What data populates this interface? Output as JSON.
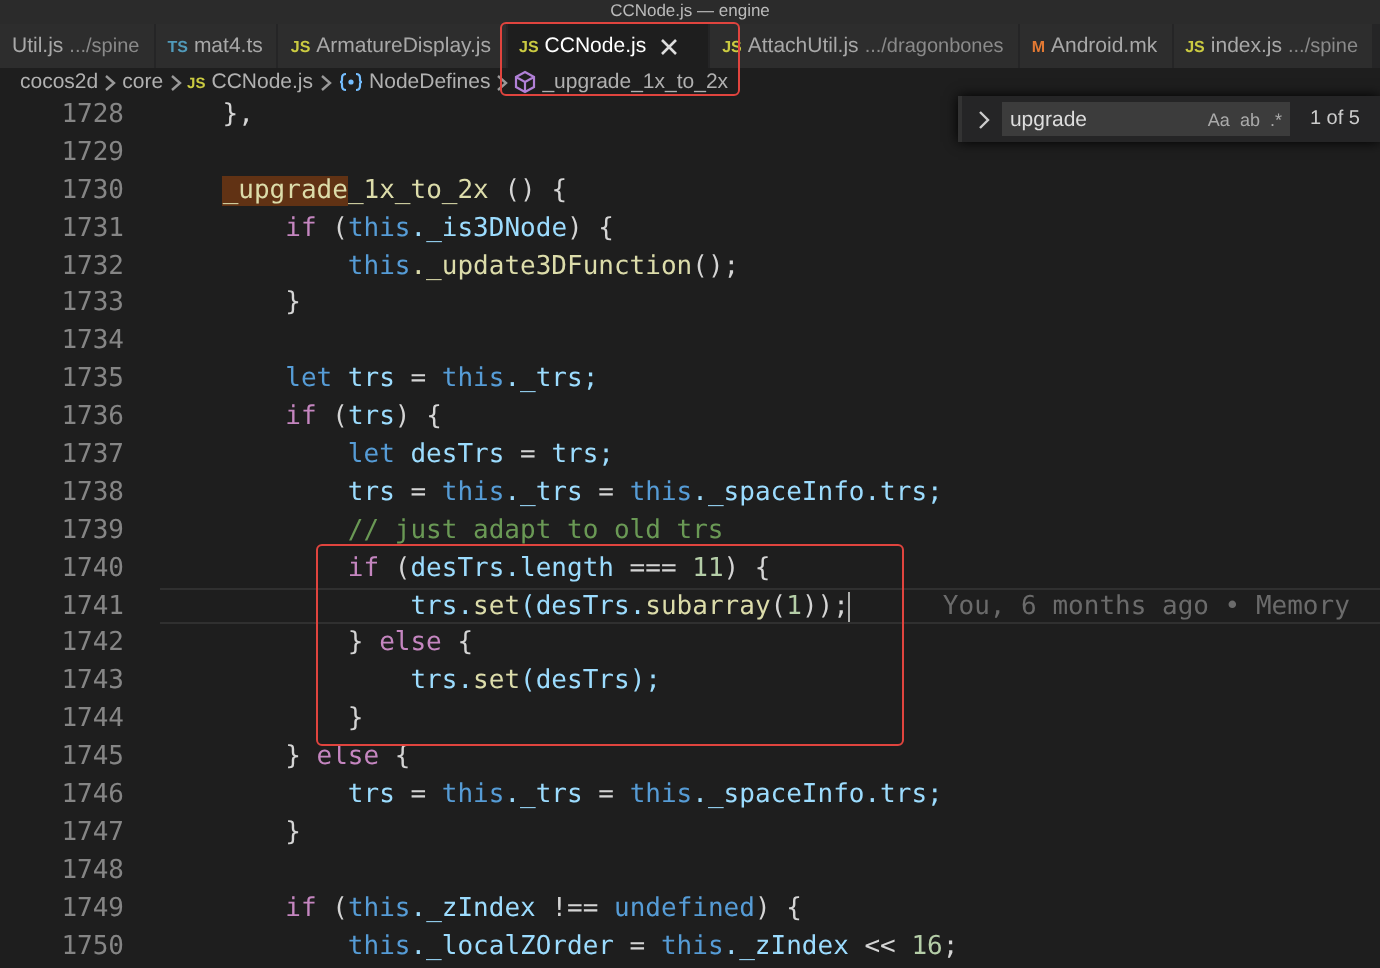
{
  "window": {
    "title": "CCNode.js — engine"
  },
  "tabs": [
    {
      "label": "Util.js",
      "path": ".../spine",
      "selected": false
    },
    {
      "label": "mat4.ts",
      "badge": "TS",
      "kind": "ts",
      "selected": false
    },
    {
      "label": "ArmatureDisplay.js",
      "badge": "JS",
      "kind": "js",
      "selected": false
    },
    {
      "label": "CCNode.js",
      "badge": "JS",
      "kind": "js",
      "selected": true
    },
    {
      "label": "AttachUtil.js",
      "path": ".../dragonbones",
      "badge": "JS",
      "kind": "js",
      "selected": false
    },
    {
      "label": "Android.mk",
      "badge": "M",
      "kind": "make",
      "selected": false
    },
    {
      "label": "index.js",
      "path": ".../spine",
      "badge": "JS",
      "kind": "js",
      "selected": false
    }
  ],
  "breadcrumbs": [
    {
      "label": "cocos2d",
      "kind": "folder"
    },
    {
      "label": "core",
      "kind": "folder"
    },
    {
      "label": "CCNode.js",
      "badge": "JS",
      "kind": "file"
    },
    {
      "label": "NodeDefines",
      "kind": "namespace"
    },
    {
      "label": "_upgrade_1x_to_2x",
      "kind": "method"
    }
  ],
  "find_widget": {
    "value": "upgrade",
    "toggles": [
      "Aa",
      "ab",
      ".*"
    ],
    "result": "1 of 5"
  },
  "lines": [
    {
      "number": "1728",
      "current": false,
      "tokens": [
        {
          "text": "    },",
          "kind": "plain"
        }
      ]
    },
    {
      "number": "1729",
      "current": false
    },
    {
      "number": "1730",
      "current": false,
      "tokens": [
        {
          "text": "    _upgrade",
          "kind": "match"
        },
        {
          "text": "_1x_to_2x",
          "kind": "function"
        },
        {
          "text": " () {",
          "kind": "plain"
        }
      ]
    },
    {
      "number": "1731",
      "current": false,
      "tokens": [
        {
          "text": "        if",
          "kind": "keyword"
        },
        {
          "text": " (",
          "kind": "plain"
        },
        {
          "text": "this",
          "kind": "storage"
        },
        {
          "text": "._is3DNode",
          "kind": "variable"
        },
        {
          "text": ") {",
          "kind": "plain"
        }
      ]
    },
    {
      "number": "1732",
      "current": false,
      "tokens": [
        {
          "text": "            this",
          "kind": "storage"
        },
        {
          "text": "._update3DFunction",
          "kind": "function"
        },
        {
          "text": "();",
          "kind": "plain"
        }
      ]
    },
    {
      "number": "1733",
      "current": false,
      "tokens": [
        {
          "text": "        }",
          "kind": "plain"
        }
      ]
    },
    {
      "number": "1734",
      "current": false
    },
    {
      "number": "1735",
      "current": false,
      "tokens": [
        {
          "text": "        let",
          "kind": "storage"
        },
        {
          "text": " trs",
          "kind": "variable"
        },
        {
          "text": " = ",
          "kind": "plain"
        },
        {
          "text": "this",
          "kind": "storage"
        },
        {
          "text": "._trs;",
          "kind": "variable"
        }
      ]
    },
    {
      "number": "1736",
      "current": false,
      "tokens": [
        {
          "text": "        if",
          "kind": "keyword"
        },
        {
          "text": " (",
          "kind": "plain"
        },
        {
          "text": "trs",
          "kind": "variable"
        },
        {
          "text": ") {",
          "kind": "plain"
        }
      ]
    },
    {
      "number": "1737",
      "current": false,
      "tokens": [
        {
          "text": "            let",
          "kind": "storage"
        },
        {
          "text": " desTrs",
          "kind": "variable"
        },
        {
          "text": " = ",
          "kind": "plain"
        },
        {
          "text": "trs;",
          "kind": "variable"
        }
      ]
    },
    {
      "number": "1738",
      "current": false,
      "tokens": [
        {
          "text": "            trs",
          "kind": "variable"
        },
        {
          "text": " = ",
          "kind": "plain"
        },
        {
          "text": "this",
          "kind": "storage"
        },
        {
          "text": "._trs",
          "kind": "variable"
        },
        {
          "text": " = ",
          "kind": "plain"
        },
        {
          "text": "this",
          "kind": "storage"
        },
        {
          "text": "._spaceInfo.trs;",
          "kind": "variable"
        }
      ]
    },
    {
      "number": "1739",
      "current": false,
      "tokens": [
        {
          "text": "            // just adapt to old trs",
          "kind": "comment"
        }
      ]
    },
    {
      "number": "1740",
      "current": false,
      "tokens": [
        {
          "text": "            if",
          "kind": "keyword"
        },
        {
          "text": " (",
          "kind": "plain"
        },
        {
          "text": "desTrs.length",
          "kind": "variable"
        },
        {
          "text": " === ",
          "kind": "plain"
        },
        {
          "text": "11",
          "kind": "number"
        },
        {
          "text": ") {",
          "kind": "plain"
        }
      ]
    },
    {
      "number": "1741",
      "current": true,
      "blame": "You, 6 months ago • Memory",
      "tokens": [
        {
          "text": "                trs.",
          "kind": "variable"
        },
        {
          "text": "set",
          "kind": "function"
        },
        {
          "text": "(desTrs.",
          "kind": "variable"
        },
        {
          "text": "subarray",
          "kind": "function"
        },
        {
          "text": "(",
          "kind": "plain"
        },
        {
          "text": "1",
          "kind": "number"
        },
        {
          "text": "));",
          "kind": "plain"
        }
      ]
    },
    {
      "number": "1742",
      "current": false,
      "tokens": [
        {
          "text": "            } ",
          "kind": "plain"
        },
        {
          "text": "else",
          "kind": "keyword"
        },
        {
          "text": " {",
          "kind": "plain"
        }
      ]
    },
    {
      "number": "1743",
      "current": false,
      "tokens": [
        {
          "text": "                trs.",
          "kind": "variable"
        },
        {
          "text": "set",
          "kind": "function"
        },
        {
          "text": "(desTrs);",
          "kind": "variable"
        }
      ]
    },
    {
      "number": "1744",
      "current": false,
      "tokens": [
        {
          "text": "            }",
          "kind": "plain"
        }
      ]
    },
    {
      "number": "1745",
      "current": false,
      "tokens": [
        {
          "text": "        } ",
          "kind": "plain"
        },
        {
          "text": "else",
          "kind": "keyword"
        },
        {
          "text": " {",
          "kind": "plain"
        }
      ]
    },
    {
      "number": "1746",
      "current": false,
      "tokens": [
        {
          "text": "            trs",
          "kind": "variable"
        },
        {
          "text": " = ",
          "kind": "plain"
        },
        {
          "text": "this",
          "kind": "storage"
        },
        {
          "text": "._trs",
          "kind": "variable"
        },
        {
          "text": " = ",
          "kind": "plain"
        },
        {
          "text": "this",
          "kind": "storage"
        },
        {
          "text": "._spaceInfo.trs;",
          "kind": "variable"
        }
      ]
    },
    {
      "number": "1747",
      "current": false,
      "tokens": [
        {
          "text": "        }",
          "kind": "plain"
        }
      ]
    },
    {
      "number": "1748",
      "current": false
    },
    {
      "number": "1749",
      "current": false,
      "tokens": [
        {
          "text": "        if",
          "kind": "keyword"
        },
        {
          "text": " (",
          "kind": "plain"
        },
        {
          "text": "this",
          "kind": "storage"
        },
        {
          "text": "._zIndex",
          "kind": "variable"
        },
        {
          "text": " !== ",
          "kind": "plain"
        },
        {
          "text": "undefined",
          "kind": "storage"
        },
        {
          "text": ") {",
          "kind": "plain"
        }
      ]
    },
    {
      "number": "1750",
      "current": false,
      "tokens": [
        {
          "text": "            this",
          "kind": "storage"
        },
        {
          "text": "._localZOrder",
          "kind": "variable"
        },
        {
          "text": " = ",
          "kind": "plain"
        },
        {
          "text": "this",
          "kind": "storage"
        },
        {
          "text": "._zIndex",
          "kind": "variable"
        },
        {
          "text": " << ",
          "kind": "plain"
        },
        {
          "text": "16",
          "kind": "number"
        },
        {
          "text": ";",
          "kind": "plain"
        }
      ]
    }
  ]
}
